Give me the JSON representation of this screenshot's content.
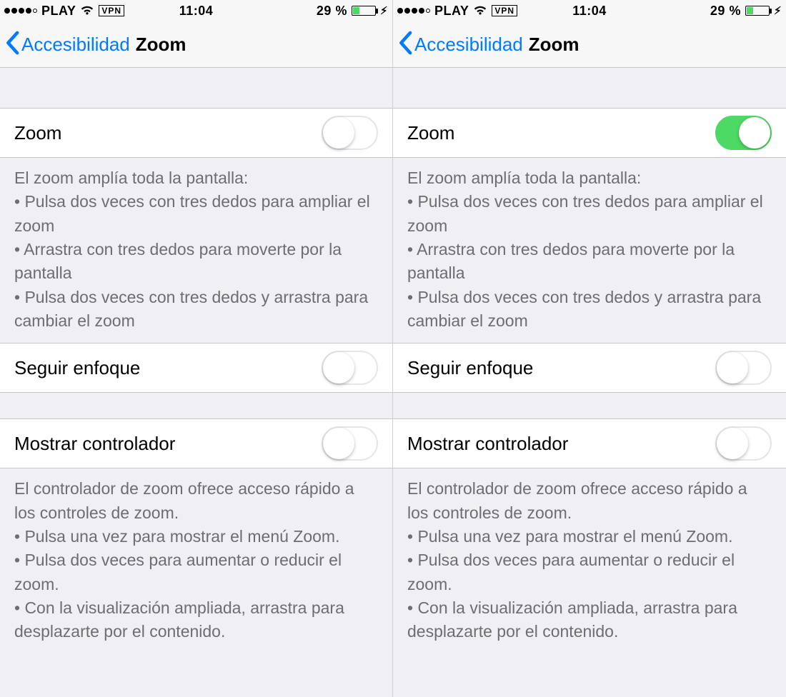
{
  "statusbar": {
    "carrier": "PLAY",
    "vpn": "VPN",
    "time": "11:04",
    "battery_pct": "29 %"
  },
  "nav": {
    "back": "Accesibilidad",
    "title": "Zoom"
  },
  "rows": {
    "zoom": "Zoom",
    "follow_focus": "Seguir enfoque",
    "show_controller": "Mostrar controlador"
  },
  "footer1": {
    "title": "El zoom amplía toda la pantalla:",
    "b1": "•  Pulsa dos veces con tres dedos para ampliar el zoom",
    "b2": "•  Arrastra con tres dedos para moverte por la pantalla",
    "b3": "•  Pulsa dos veces con tres dedos y arrastra para cambiar el zoom"
  },
  "footer2": {
    "title": "El controlador de zoom ofrece acceso rápido a los controles de zoom.",
    "b1": "• Pulsa una vez para mostrar el menú Zoom.",
    "b2": "• Pulsa dos veces para aumentar o reducir el zoom.",
    "b3": "• Con la visualización ampliada, arrastra para desplazarte por el contenido."
  },
  "left": {
    "zoom_on": false,
    "follow_on": false,
    "controller_on": false
  },
  "right": {
    "zoom_on": true,
    "follow_on": false,
    "controller_on": false
  }
}
